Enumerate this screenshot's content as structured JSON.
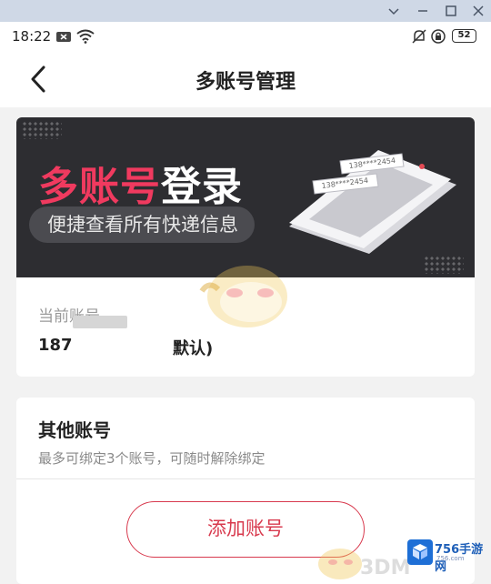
{
  "window": {
    "controls": [
      "chevron-down-icon",
      "minimize-icon",
      "maximize-icon",
      "close-icon"
    ]
  },
  "status_bar": {
    "time": "18:22",
    "battery": "52"
  },
  "header": {
    "title": "多账号管理"
  },
  "banner": {
    "headline_accent": "多账号",
    "headline_rest": "登录",
    "subtitle": "便捷查看所有快递信息",
    "phone_number_1": "138****2454",
    "phone_number_2": "138****2454"
  },
  "current_account": {
    "label": "当前账号",
    "number_prefix": "187",
    "tag_suffix": "默认)"
  },
  "other_accounts": {
    "title": "其他账号",
    "hint": "最多可绑定3个账号，可随时解除绑定",
    "add_button": "添加账号"
  },
  "watermark": {
    "site": "756手游网",
    "url": "756.com",
    "brand": "3DM"
  },
  "colors": {
    "accent": "#d83a4e",
    "banner_red": "#f03a5f",
    "banner_bg": "#2d2d31",
    "page_bg": "#f2f2f2"
  }
}
